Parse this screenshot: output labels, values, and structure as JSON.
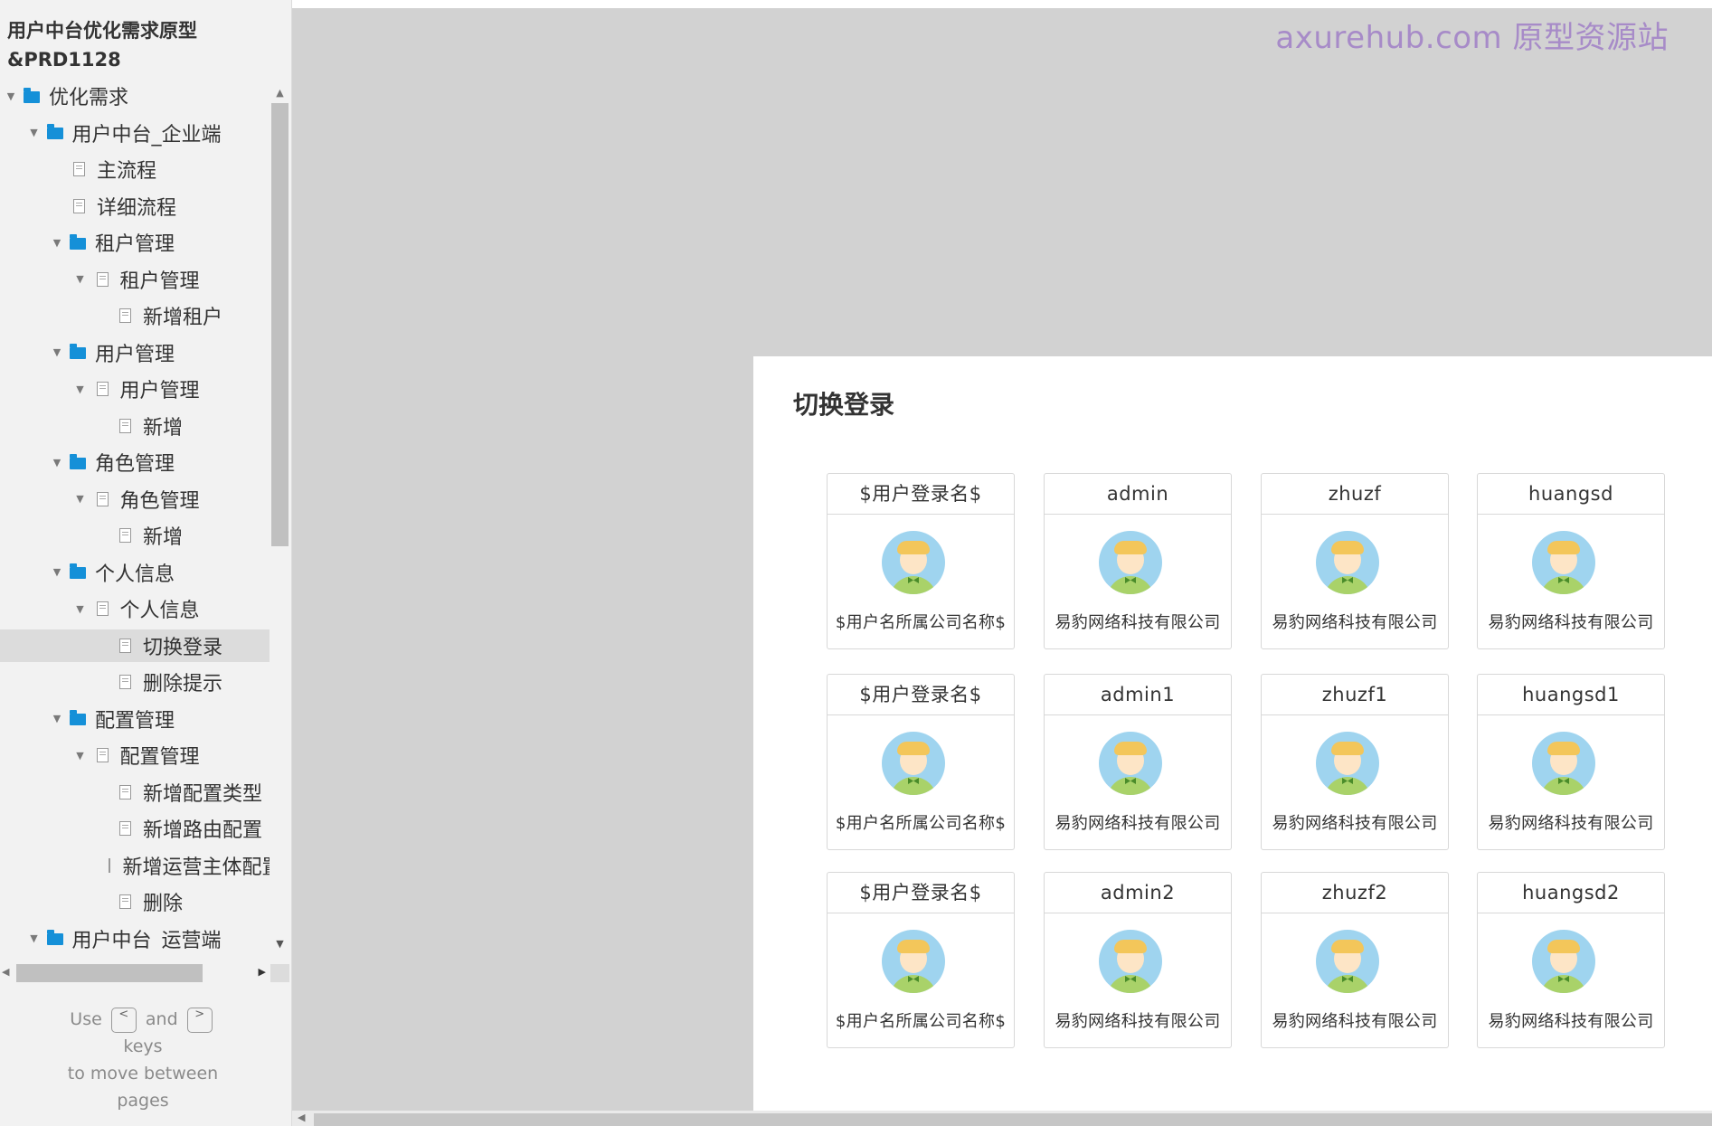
{
  "sidebar": {
    "project_title": "用户中台优化需求原型&PRD1128",
    "tree": [
      {
        "label": "优化需求",
        "type": "folder",
        "level": 0,
        "expanded": true
      },
      {
        "label": "用户中台_企业端",
        "type": "folder",
        "level": 1,
        "expanded": true
      },
      {
        "label": "主流程",
        "type": "page",
        "level": 2
      },
      {
        "label": "详细流程",
        "type": "page",
        "level": 2
      },
      {
        "label": "租户管理",
        "type": "folder",
        "level": 2,
        "expanded": true
      },
      {
        "label": "租户管理",
        "type": "page",
        "level": 3,
        "expanded": true
      },
      {
        "label": "新增租户",
        "type": "page",
        "level": 4
      },
      {
        "label": "用户管理",
        "type": "folder",
        "level": 2,
        "expanded": true
      },
      {
        "label": "用户管理",
        "type": "page",
        "level": 3,
        "expanded": true
      },
      {
        "label": "新增",
        "type": "page",
        "level": 4
      },
      {
        "label": "角色管理",
        "type": "folder",
        "level": 2,
        "expanded": true
      },
      {
        "label": "角色管理",
        "type": "page",
        "level": 3,
        "expanded": true
      },
      {
        "label": "新增",
        "type": "page",
        "level": 4
      },
      {
        "label": "个人信息",
        "type": "folder",
        "level": 2,
        "expanded": true
      },
      {
        "label": "个人信息",
        "type": "page",
        "level": 3,
        "expanded": true
      },
      {
        "label": "切换登录",
        "type": "page",
        "level": 4,
        "selected": true
      },
      {
        "label": "删除提示",
        "type": "page",
        "level": 4
      },
      {
        "label": "配置管理",
        "type": "folder",
        "level": 2,
        "expanded": true
      },
      {
        "label": "配置管理",
        "type": "page",
        "level": 3,
        "expanded": true
      },
      {
        "label": "新增配置类型",
        "type": "page",
        "level": 4
      },
      {
        "label": "新增路由配置",
        "type": "page",
        "level": 4
      },
      {
        "label": "新增运营主体配置",
        "type": "page",
        "level": 4
      },
      {
        "label": "删除",
        "type": "page",
        "level": 4
      },
      {
        "label": "用户中台_运营端",
        "type": "folder",
        "level": 1,
        "expanded": true
      }
    ],
    "nav_hint": {
      "use": "Use",
      "key_prev": "<",
      "and": "and",
      "key_next": ">",
      "keys": "keys",
      "line3": "to move between",
      "line4": "pages"
    }
  },
  "watermark": "axurehub.com 原型资源站",
  "panel": {
    "title": "切换登录",
    "accounts": [
      {
        "name": "$用户登录名$",
        "company": "$用户名所属公司名称$"
      },
      {
        "name": "admin",
        "company": "易豹网络科技有限公司"
      },
      {
        "name": "zhuzf",
        "company": "易豹网络科技有限公司"
      },
      {
        "name": "huangsd",
        "company": "易豹网络科技有限公司"
      },
      {
        "name": "$用户登录名$",
        "company": "$用户名所属公司名称$"
      },
      {
        "name": "admin1",
        "company": "易豹网络科技有限公司"
      },
      {
        "name": "zhuzf1",
        "company": "易豹网络科技有限公司"
      },
      {
        "name": "huangsd1",
        "company": "易豹网络科技有限公司"
      },
      {
        "name": "$用户登录名$",
        "company": "$用户名所属公司名称$"
      },
      {
        "name": "admin2",
        "company": "易豹网络科技有限公司"
      },
      {
        "name": "zhuzf2",
        "company": "易豹网络科技有限公司"
      },
      {
        "name": "huangsd2",
        "company": "易豹网络科技有限公司"
      }
    ]
  },
  "colors": {
    "folder_icon": "#1590d8",
    "watermark": "#a78bc8",
    "canvas_bg": "#d2d2d2",
    "selected_row": "#dcdcdc"
  }
}
